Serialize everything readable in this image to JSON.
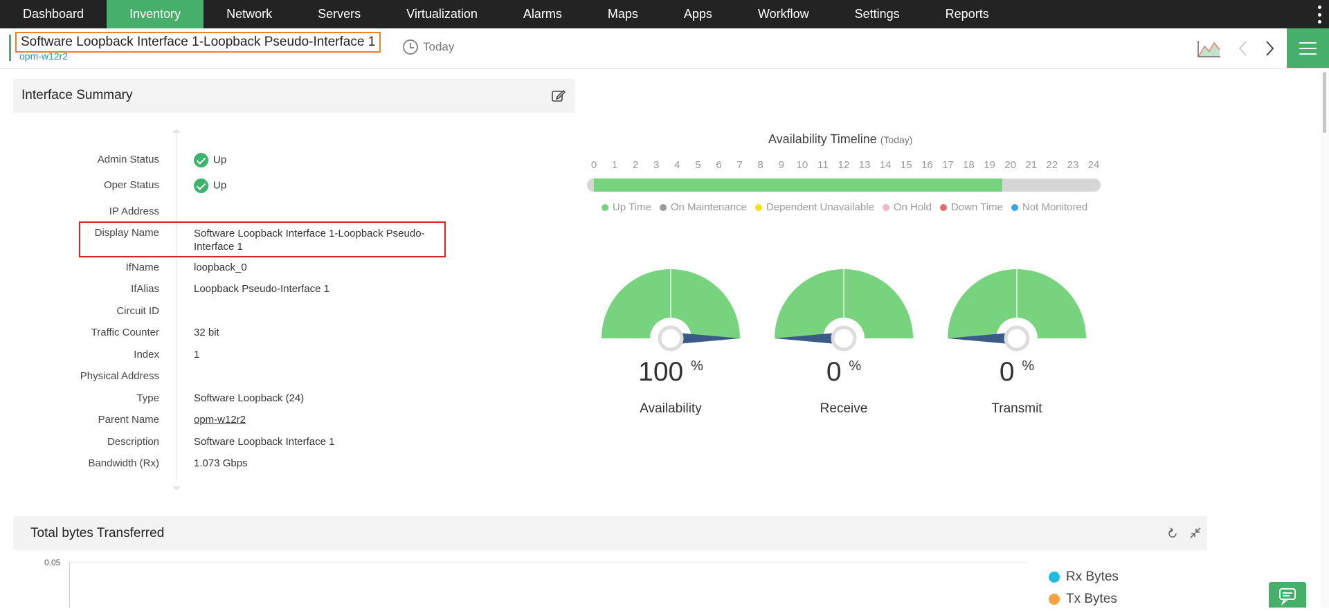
{
  "nav": {
    "items": [
      "Dashboard",
      "Inventory",
      "Network",
      "Servers",
      "Virtualization",
      "Alarms",
      "Maps",
      "Apps",
      "Workflow",
      "Settings",
      "Reports"
    ],
    "active": "Inventory"
  },
  "header": {
    "title": "Software Loopback Interface 1-Loopback Pseudo-Interface 1",
    "device": "opm-w12r2",
    "period": "Today"
  },
  "summary": {
    "title": "Interface Summary",
    "rows": [
      {
        "label": "Admin Status",
        "value": "Up",
        "status": "up"
      },
      {
        "label": "Oper Status",
        "value": "Up",
        "status": "up"
      },
      {
        "label": "IP Address",
        "value": ""
      },
      {
        "label": "Display Name",
        "value": "Software Loopback Interface 1-Loopback Pseudo-\nInterface 1"
      },
      {
        "label": "IfName",
        "value": "loopback_0"
      },
      {
        "label": "IfAlias",
        "value": "Loopback Pseudo-Interface 1"
      },
      {
        "label": "Circuit ID",
        "value": ""
      },
      {
        "label": "Traffic Counter",
        "value": "32 bit"
      },
      {
        "label": "Index",
        "value": "1"
      },
      {
        "label": "Physical Address",
        "value": ""
      },
      {
        "label": "Type",
        "value": "Software Loopback (24)"
      },
      {
        "label": "Parent Name",
        "value": "opm-w12r2",
        "link": true
      },
      {
        "label": "Description",
        "value": "Software Loopback Interface 1"
      },
      {
        "label": "Bandwidth (Rx)",
        "value": "1.073 Gbps"
      }
    ]
  },
  "timeline": {
    "title": "Availability Timeline",
    "qualifier": "(Today)",
    "hours": [
      "0",
      "1",
      "2",
      "3",
      "4",
      "5",
      "6",
      "7",
      "8",
      "9",
      "10",
      "11",
      "12",
      "13",
      "14",
      "15",
      "16",
      "17",
      "18",
      "19",
      "20",
      "21",
      "22",
      "23",
      "24"
    ],
    "uptime_until_hour": 19.6,
    "legend": [
      {
        "label": "Up Time",
        "color": "#78d37e"
      },
      {
        "label": "On Maintenance",
        "color": "#9a9a9a"
      },
      {
        "label": "Dependent Unavailable",
        "color": "#f2e21b"
      },
      {
        "label": "On Hold",
        "color": "#f3b6c8"
      },
      {
        "label": "Down Time",
        "color": "#ee6a6a"
      },
      {
        "label": "Not Monitored",
        "color": "#3aa4e8"
      }
    ]
  },
  "gauges": [
    {
      "label": "Availability",
      "value": "100",
      "unit": "%",
      "percent": 100
    },
    {
      "label": "Receive",
      "value": "0",
      "unit": "%",
      "percent": 0
    },
    {
      "label": "Transmit",
      "value": "0",
      "unit": "%",
      "percent": 0
    }
  ],
  "bytes": {
    "title": "Total bytes Transferred",
    "y_tick": "0.05",
    "legend": [
      {
        "label": "Rx Bytes",
        "color": "#1fbde0"
      },
      {
        "label": "Tx Bytes",
        "color": "#f5a340"
      }
    ]
  },
  "colors": {
    "accent": "#46b06a",
    "gauge_fill": "#78d37e",
    "needle": "#3b5a86"
  }
}
